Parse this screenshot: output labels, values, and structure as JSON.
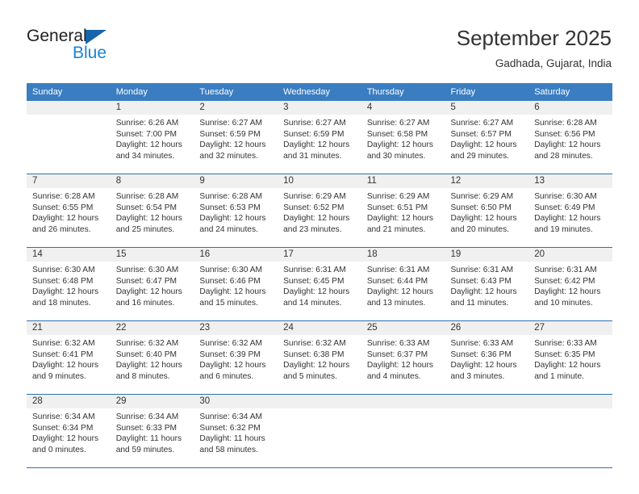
{
  "brand": {
    "name_part1": "General",
    "name_part2": "Blue",
    "logo_icon": "triangle-logo-icon"
  },
  "header": {
    "title": "September 2025",
    "subtitle": "Gadhada, Gujarat, India"
  },
  "colors": {
    "header_band": "#3a7dc1",
    "week_separator": "#2f6fad",
    "daynum_band": "#f0f0f0",
    "brand_blue": "#1b84d1",
    "text": "#333333"
  },
  "weekday_headers": [
    "Sunday",
    "Monday",
    "Tuesday",
    "Wednesday",
    "Thursday",
    "Friday",
    "Saturday"
  ],
  "weeks": [
    [
      {
        "day": "",
        "lines": []
      },
      {
        "day": "1",
        "lines": [
          "Sunrise: 6:26 AM",
          "Sunset: 7:00 PM",
          "Daylight: 12 hours",
          "and 34 minutes."
        ]
      },
      {
        "day": "2",
        "lines": [
          "Sunrise: 6:27 AM",
          "Sunset: 6:59 PM",
          "Daylight: 12 hours",
          "and 32 minutes."
        ]
      },
      {
        "day": "3",
        "lines": [
          "Sunrise: 6:27 AM",
          "Sunset: 6:59 PM",
          "Daylight: 12 hours",
          "and 31 minutes."
        ]
      },
      {
        "day": "4",
        "lines": [
          "Sunrise: 6:27 AM",
          "Sunset: 6:58 PM",
          "Daylight: 12 hours",
          "and 30 minutes."
        ]
      },
      {
        "day": "5",
        "lines": [
          "Sunrise: 6:27 AM",
          "Sunset: 6:57 PM",
          "Daylight: 12 hours",
          "and 29 minutes."
        ]
      },
      {
        "day": "6",
        "lines": [
          "Sunrise: 6:28 AM",
          "Sunset: 6:56 PM",
          "Daylight: 12 hours",
          "and 28 minutes."
        ]
      }
    ],
    [
      {
        "day": "7",
        "lines": [
          "Sunrise: 6:28 AM",
          "Sunset: 6:55 PM",
          "Daylight: 12 hours",
          "and 26 minutes."
        ]
      },
      {
        "day": "8",
        "lines": [
          "Sunrise: 6:28 AM",
          "Sunset: 6:54 PM",
          "Daylight: 12 hours",
          "and 25 minutes."
        ]
      },
      {
        "day": "9",
        "lines": [
          "Sunrise: 6:28 AM",
          "Sunset: 6:53 PM",
          "Daylight: 12 hours",
          "and 24 minutes."
        ]
      },
      {
        "day": "10",
        "lines": [
          "Sunrise: 6:29 AM",
          "Sunset: 6:52 PM",
          "Daylight: 12 hours",
          "and 23 minutes."
        ]
      },
      {
        "day": "11",
        "lines": [
          "Sunrise: 6:29 AM",
          "Sunset: 6:51 PM",
          "Daylight: 12 hours",
          "and 21 minutes."
        ]
      },
      {
        "day": "12",
        "lines": [
          "Sunrise: 6:29 AM",
          "Sunset: 6:50 PM",
          "Daylight: 12 hours",
          "and 20 minutes."
        ]
      },
      {
        "day": "13",
        "lines": [
          "Sunrise: 6:30 AM",
          "Sunset: 6:49 PM",
          "Daylight: 12 hours",
          "and 19 minutes."
        ]
      }
    ],
    [
      {
        "day": "14",
        "lines": [
          "Sunrise: 6:30 AM",
          "Sunset: 6:48 PM",
          "Daylight: 12 hours",
          "and 18 minutes."
        ]
      },
      {
        "day": "15",
        "lines": [
          "Sunrise: 6:30 AM",
          "Sunset: 6:47 PM",
          "Daylight: 12 hours",
          "and 16 minutes."
        ]
      },
      {
        "day": "16",
        "lines": [
          "Sunrise: 6:30 AM",
          "Sunset: 6:46 PM",
          "Daylight: 12 hours",
          "and 15 minutes."
        ]
      },
      {
        "day": "17",
        "lines": [
          "Sunrise: 6:31 AM",
          "Sunset: 6:45 PM",
          "Daylight: 12 hours",
          "and 14 minutes."
        ]
      },
      {
        "day": "18",
        "lines": [
          "Sunrise: 6:31 AM",
          "Sunset: 6:44 PM",
          "Daylight: 12 hours",
          "and 13 minutes."
        ]
      },
      {
        "day": "19",
        "lines": [
          "Sunrise: 6:31 AM",
          "Sunset: 6:43 PM",
          "Daylight: 12 hours",
          "and 11 minutes."
        ]
      },
      {
        "day": "20",
        "lines": [
          "Sunrise: 6:31 AM",
          "Sunset: 6:42 PM",
          "Daylight: 12 hours",
          "and 10 minutes."
        ]
      }
    ],
    [
      {
        "day": "21",
        "lines": [
          "Sunrise: 6:32 AM",
          "Sunset: 6:41 PM",
          "Daylight: 12 hours",
          "and 9 minutes."
        ]
      },
      {
        "day": "22",
        "lines": [
          "Sunrise: 6:32 AM",
          "Sunset: 6:40 PM",
          "Daylight: 12 hours",
          "and 8 minutes."
        ]
      },
      {
        "day": "23",
        "lines": [
          "Sunrise: 6:32 AM",
          "Sunset: 6:39 PM",
          "Daylight: 12 hours",
          "and 6 minutes."
        ]
      },
      {
        "day": "24",
        "lines": [
          "Sunrise: 6:32 AM",
          "Sunset: 6:38 PM",
          "Daylight: 12 hours",
          "and 5 minutes."
        ]
      },
      {
        "day": "25",
        "lines": [
          "Sunrise: 6:33 AM",
          "Sunset: 6:37 PM",
          "Daylight: 12 hours",
          "and 4 minutes."
        ]
      },
      {
        "day": "26",
        "lines": [
          "Sunrise: 6:33 AM",
          "Sunset: 6:36 PM",
          "Daylight: 12 hours",
          "and 3 minutes."
        ]
      },
      {
        "day": "27",
        "lines": [
          "Sunrise: 6:33 AM",
          "Sunset: 6:35 PM",
          "Daylight: 12 hours",
          "and 1 minute."
        ]
      }
    ],
    [
      {
        "day": "28",
        "lines": [
          "Sunrise: 6:34 AM",
          "Sunset: 6:34 PM",
          "Daylight: 12 hours",
          "and 0 minutes."
        ]
      },
      {
        "day": "29",
        "lines": [
          "Sunrise: 6:34 AM",
          "Sunset: 6:33 PM",
          "Daylight: 11 hours",
          "and 59 minutes."
        ]
      },
      {
        "day": "30",
        "lines": [
          "Sunrise: 6:34 AM",
          "Sunset: 6:32 PM",
          "Daylight: 11 hours",
          "and 58 minutes."
        ]
      },
      {
        "day": "",
        "lines": []
      },
      {
        "day": "",
        "lines": []
      },
      {
        "day": "",
        "lines": []
      },
      {
        "day": "",
        "lines": []
      }
    ]
  ]
}
